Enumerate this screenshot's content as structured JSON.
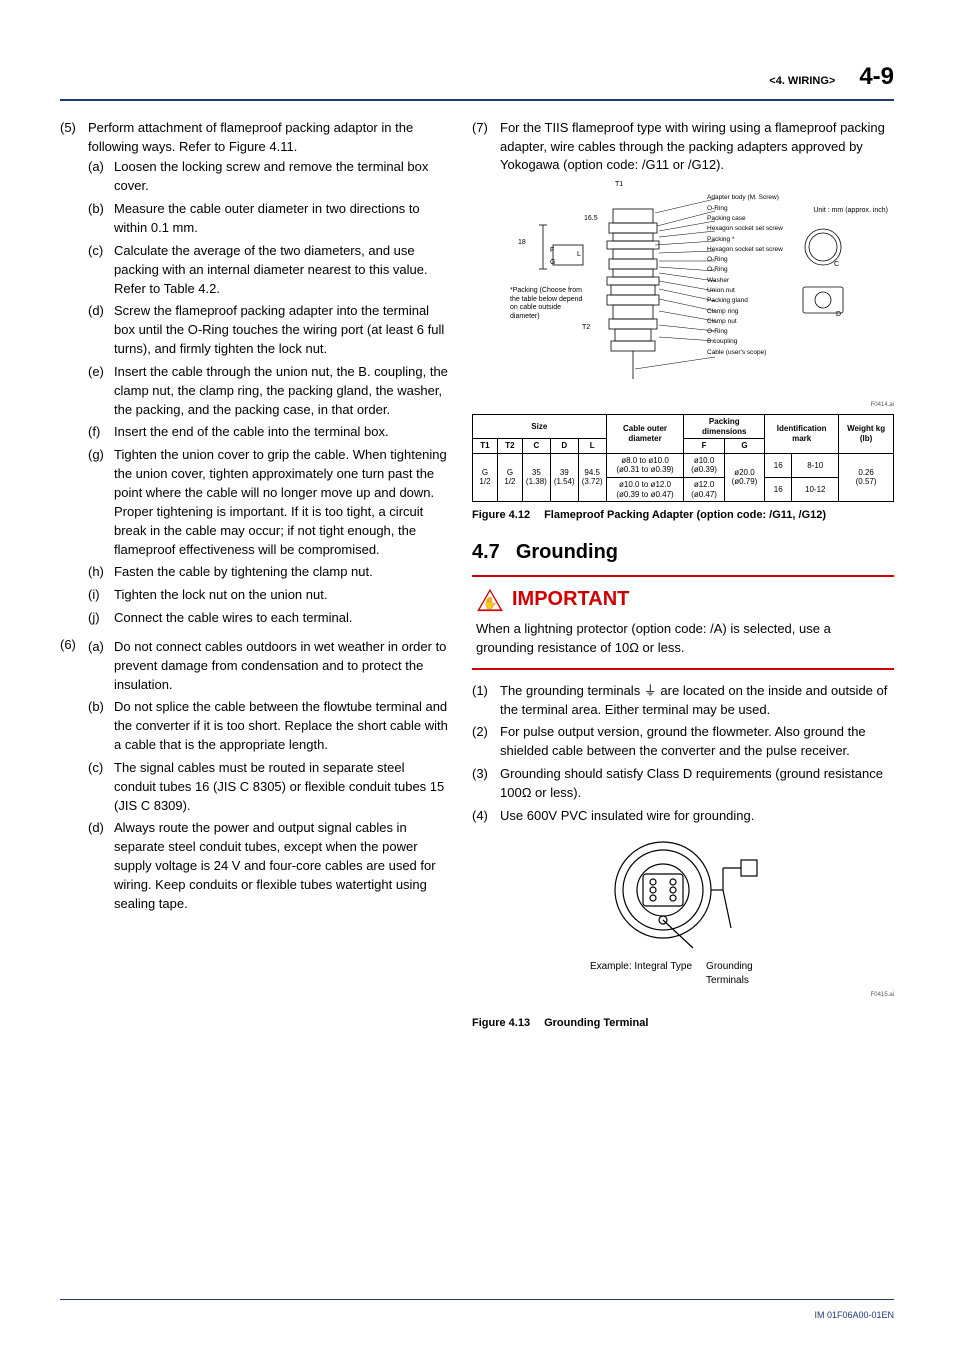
{
  "header": {
    "section": "<4.  WIRING>",
    "pagenum": "4-9"
  },
  "left": {
    "item5_marker": "(5)",
    "item5_text": "Perform attachment of flameproof packing adaptor in the following ways. Refer to Figure 4.11.",
    "sub5": [
      {
        "m": "(a)",
        "t": "Loosen the locking screw and remove the terminal box cover."
      },
      {
        "m": "(b)",
        "t": "Measure the cable outer diameter in two directions to within 0.1 mm."
      },
      {
        "m": "(c)",
        "t": "Calculate the average of the two diameters, and use packing with an internal diameter nearest to this value. Refer to Table 4.2."
      },
      {
        "m": "(d)",
        "t": "Screw the flameproof packing adapter into the terminal box until the O-Ring touches the wiring port (at least 6 full turns), and firmly tighten the lock nut."
      },
      {
        "m": "(e)",
        "t": "Insert the cable through the union nut, the B. coupling, the clamp nut, the clamp ring, the packing gland, the washer, the packing, and the packing case, in that order."
      },
      {
        "m": "(f)",
        "t": "Insert the end of the cable into the terminal box."
      },
      {
        "m": "(g)",
        "t": "Tighten the union cover to grip the cable. When tightening the union cover, tighten approximately one turn past the point where the cable will no longer move up and down. Proper tightening is important. If it is too tight, a circuit break in the cable may occur; if not tight enough, the flameproof effectiveness will be compromised."
      },
      {
        "m": "(h)",
        "t": "Fasten the cable by tightening the clamp nut."
      },
      {
        "m": "(i)",
        "t": "Tighten the lock nut on the union nut."
      },
      {
        "m": "(j)",
        "t": "Connect the cable wires to each terminal."
      }
    ],
    "item6_marker": "(6)",
    "sub6": [
      {
        "m": "(a)",
        "t": "Do not connect cables outdoors in wet weather in order to prevent damage from condensation and to protect the insulation."
      },
      {
        "m": "(b)",
        "t": "Do not splice the cable between the flowtube terminal and the converter if it is too short. Replace the short cable with a cable that is the appropriate length."
      },
      {
        "m": "(c)",
        "t": "The signal cables must be routed in separate steel conduit tubes 16 (JIS C 8305) or flexible conduit tubes 15 (JIS C 8309)."
      },
      {
        "m": "(d)",
        "t": "Always route the power and output signal cables in separate steel conduit tubes, except when the power supply voltage is 24 V and four-core cables are used for wiring. Keep conduits or flexible tubes watertight using sealing tape."
      }
    ]
  },
  "right": {
    "item7_marker": "(7)",
    "item7_text": "For the TIIS flameproof type with wiring using a flameproof packing adapter, wire cables through the packing adapters approved by Yokogawa (option code: /G11 or /G12).",
    "diagram_labels": {
      "t1": "T1",
      "t2": "T2",
      "f": "F",
      "g": "G",
      "l": "L",
      "v18": "18",
      "v165": "16.5",
      "c": "C",
      "d": "D",
      "note": "*Packing\n(Choose from the table below depend on cable outside diameter)",
      "unit": "Unit : mm\n(approx. inch)",
      "parts": [
        "Adapter body (M. Screw)",
        "O-Ring",
        "Packing case",
        "Hexagon socket set screw",
        "Packing *",
        "Hexagon socket set screw",
        "O-Ring",
        "O-Ring",
        "Washer",
        "Union nut",
        "Packing gland",
        "Clamp ring",
        "Clamp nut",
        "O-Ring",
        "B.coupling",
        "Cable (user's scope)"
      ]
    },
    "figref412": "F0414.ai",
    "fig412_num": "Figure 4.12",
    "fig412_cap": "Flameproof Packing Adapter (option code: /G11, /G12)",
    "section_num": "4.7",
    "section_title": "Grounding",
    "important_label": "IMPORTANT",
    "important_text": "When a lightning protector (option code: /A) is selected, use a grounding resistance of 10Ω or less.",
    "grounding_list": [
      {
        "m": "(1)",
        "t": "The grounding terminals ⏚ are located on the inside and outside of the terminal area. Either terminal may be used."
      },
      {
        "m": "(2)",
        "t": "For pulse output version, ground the flowmeter. Also ground the shielded cable between the converter and the pulse receiver."
      },
      {
        "m": "(3)",
        "t": "Grounding should satisfy Class D requirements (ground resistance 100Ω or less)."
      },
      {
        "m": "(4)",
        "t": "Use 600V PVC insulated wire for grounding."
      }
    ],
    "fig413_example": "Example: Integral Type",
    "fig413_gt": "Grounding Terminals",
    "figref413": "F0415.ai",
    "fig413_num": "Figure 4.13",
    "fig413_cap": "Grounding Terminal"
  },
  "table": {
    "headers": {
      "size": "Size",
      "cable": "Cable outer diameter",
      "packing": "Packing dimensions",
      "ident": "Identification mark",
      "weight": "Weight kg (lb)",
      "t1": "T1",
      "t2": "T2",
      "c": "C",
      "d": "D",
      "l": "L",
      "f": "F",
      "g": "G"
    },
    "row": {
      "t1": "G 1/2",
      "t2": "G 1/2",
      "c": "35\n(1.38)",
      "d": "39\n(1.54)",
      "l": "94.5\n(3.72)",
      "cable1": "ø8.0 to ø10.0\n(ø0.31 to ø0.39)",
      "cable2": "ø10.0 to ø12.0\n(ø0.39 to ø0.47)",
      "f1": "ø10.0\n(ø0.39)",
      "f2": "ø12.0\n(ø0.47)",
      "g": "ø20.0\n(ø0.79)",
      "id1a": "16",
      "id1b": "8-10",
      "id2a": "16",
      "id2b": "10-12",
      "wt": "0.26\n(0.57)"
    }
  },
  "footer": "IM 01F06A00-01EN"
}
